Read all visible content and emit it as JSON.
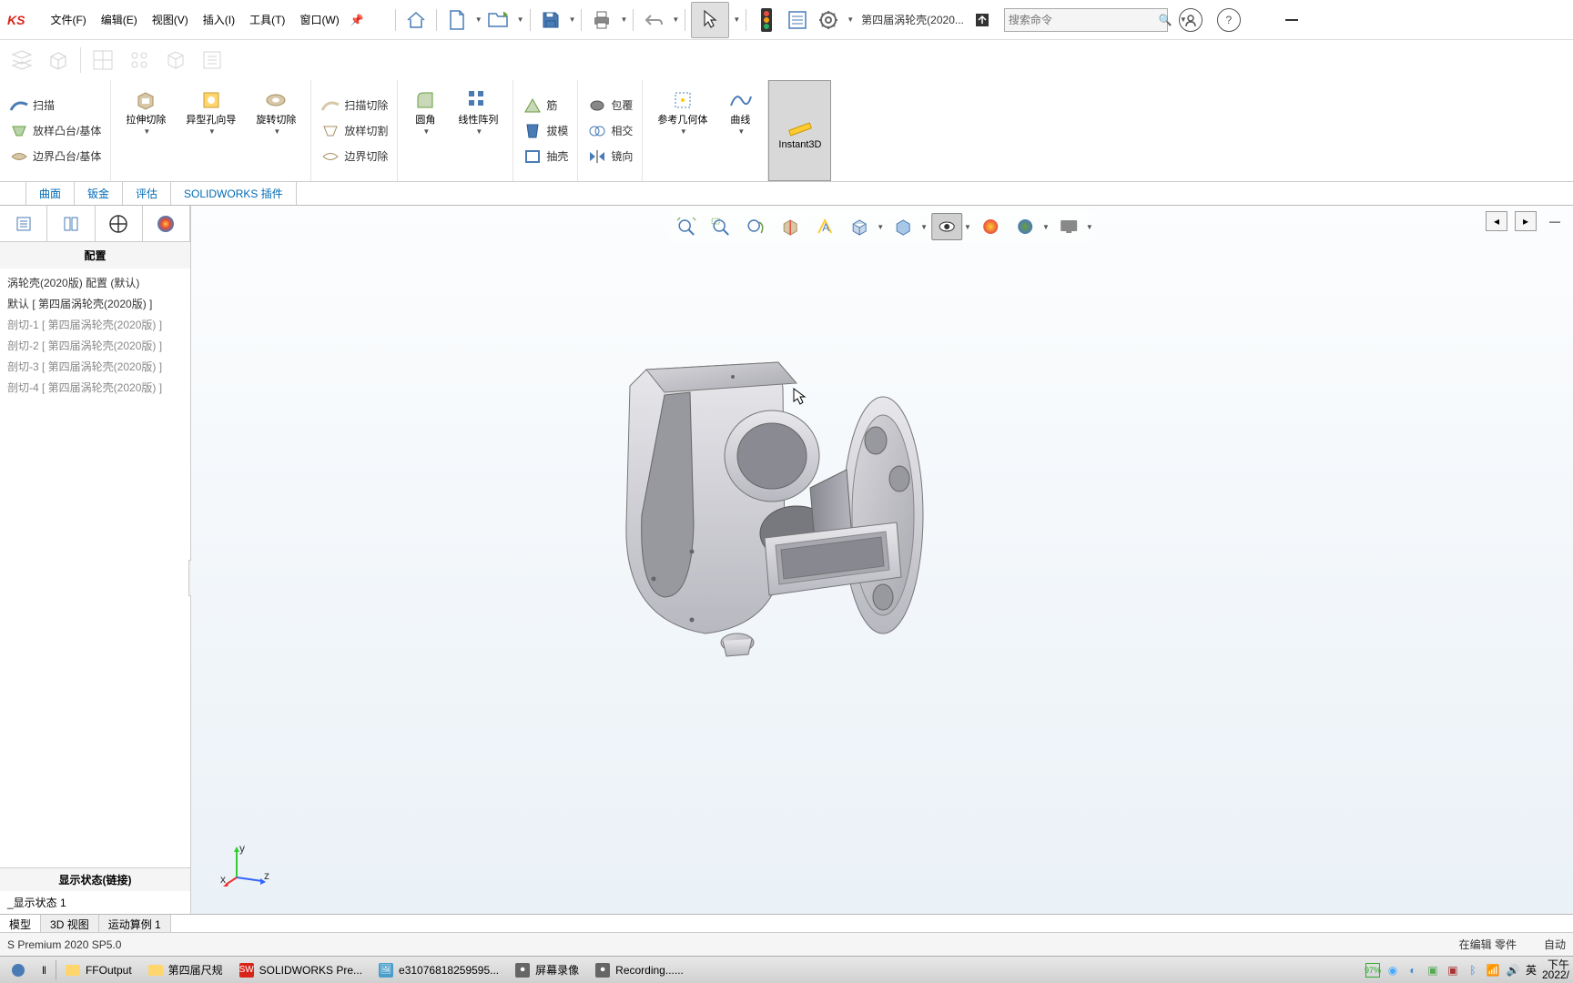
{
  "app": {
    "logo": "KS"
  },
  "menu": {
    "file": "文件(F)",
    "edit": "编辑(E)",
    "view": "视图(V)",
    "insert": "插入(I)",
    "tools": "工具(T)",
    "window": "窗口(W)"
  },
  "doc": {
    "name": "第四届涡轮壳(2020..."
  },
  "search": {
    "placeholder": "搜索命令"
  },
  "ribbon": {
    "sweep": "扫描",
    "loft": "放样凸台/基体",
    "boundary": "边界凸台/基体",
    "extrudeCut": "拉伸切除",
    "holeWizard": "异型孔向导",
    "revolveCut": "旋转切除",
    "sweepCut": "扫描切除",
    "loftCut": "放样切割",
    "boundaryCut": "边界切除",
    "fillet": "圆角",
    "linearPattern": "线性阵列",
    "rib": "筋",
    "draft": "拔模",
    "shell": "抽壳",
    "wrap": "包覆",
    "intersect": "相交",
    "mirror": "镜向",
    "refGeom": "参考几何体",
    "curves": "曲线",
    "instant3d": "Instant3D"
  },
  "ribbonTabs": {
    "t1": "曲面",
    "t2": "钣金",
    "t3": "评估",
    "t4": "SOLIDWORKS 插件"
  },
  "side": {
    "title": "配置",
    "items": [
      "涡轮壳(2020版) 配置  (默认)",
      "默认 [ 第四届涡轮壳(2020版) ]",
      "剖切-1 [ 第四届涡轮壳(2020版) ]",
      "剖切-2 [ 第四届涡轮壳(2020版) ]",
      "剖切-3 [ 第四届涡轮壳(2020版) ]",
      "剖切-4 [ 第四届涡轮壳(2020版) ]"
    ],
    "dispTitle": "显示状态(链接)",
    "dispItem": "_显示状态 1"
  },
  "bottomTabs": {
    "t1": "模型",
    "t2": "3D 视图",
    "t3": "运动算例 1"
  },
  "status": {
    "left": "S Premium 2020 SP5.0",
    "right": "在编辑 零件",
    "auto": "自动"
  },
  "taskbar": {
    "ffoutput": "FFOutput",
    "ruler": "第四届尺规",
    "sw": "SOLIDWORKS Pre...",
    "img": "e31076818259595...",
    "rec1": "屏幕录像",
    "rec2": "Recording......",
    "battery": "97%",
    "ime": "英",
    "time": "下午",
    "date": "2022/"
  }
}
